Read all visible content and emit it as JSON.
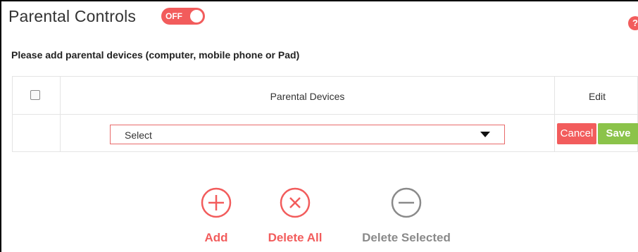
{
  "header": {
    "title": "Parental Controls",
    "toggle_label": "OFF",
    "help_icon": "question-icon",
    "help_glyph": "?"
  },
  "subtitle": "Please add parental devices (computer, mobile phone or Pad)",
  "table": {
    "columns": [
      "",
      "Parental Devices",
      "Edit"
    ],
    "row": {
      "select_value": "Select",
      "cancel_label": "Cancel",
      "save_label": "Save"
    }
  },
  "actions": [
    {
      "label": "Add",
      "icon": "plus-circle-icon"
    },
    {
      "label": "Delete All",
      "icon": "x-circle-icon"
    },
    {
      "label": "Delete Selected",
      "icon": "minus-circle-icon"
    }
  ],
  "colors": {
    "accent_red": "#f25c5c",
    "save_green": "#8bc34a",
    "muted_gray": "#8a8a8a"
  }
}
